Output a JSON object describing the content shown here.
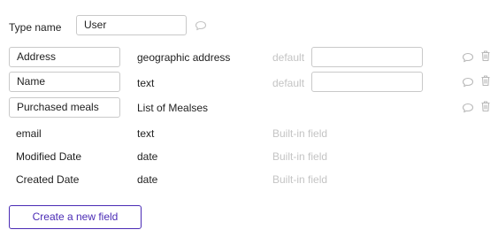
{
  "type_name": {
    "label": "Type name",
    "value": "User"
  },
  "fields": [
    {
      "name": "Address",
      "type": "geographic address",
      "default_label": "default",
      "default_value": ""
    },
    {
      "name": "Name",
      "type": "text",
      "default_label": "default",
      "default_value": ""
    },
    {
      "name": "Purchased meals",
      "type": "List of Mealses"
    }
  ],
  "builtin_fields": [
    {
      "name": "email",
      "type": "text",
      "note": "Built-in field"
    },
    {
      "name": "Modified Date",
      "type": "date",
      "note": "Built-in field"
    },
    {
      "name": "Created Date",
      "type": "date",
      "note": "Built-in field"
    }
  ],
  "create_button": {
    "label": "Create a new field"
  },
  "icons": {
    "comment": "speech-bubble-icon",
    "delete": "trash-icon"
  },
  "colors": {
    "accent": "#4a2bb5",
    "muted_text": "#c4c4c4",
    "icon": "#b9b9b9",
    "border": "#c9c9c9"
  }
}
